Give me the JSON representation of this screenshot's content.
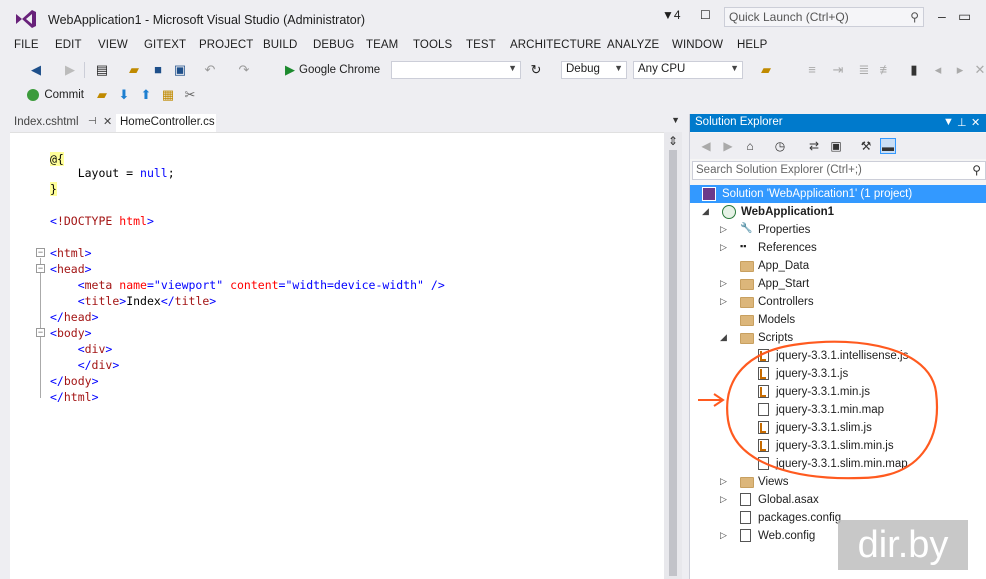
{
  "window": {
    "title": "WebApplication1 - Microsoft Visual Studio (Administrator)",
    "notification_count": "4",
    "quick_launch_placeholder": "Quick Launch (Ctrl+Q)"
  },
  "menu": [
    "FILE",
    "EDIT",
    "VIEW",
    "GITEXT",
    "PROJECT",
    "BUILD",
    "DEBUG",
    "TEAM",
    "TOOLS",
    "TEST",
    "ARCHITECTURE",
    "ANALYZE",
    "WINDOW",
    "HELP"
  ],
  "toolbar": {
    "run_target": "Google Chrome",
    "configuration": "Debug",
    "platform": "Any CPU",
    "commit_label": "Commit"
  },
  "editor": {
    "tabs": [
      {
        "label": "Index.cshtml",
        "active": false
      },
      {
        "label": "HomeController.cs",
        "active": true
      }
    ]
  },
  "solution_explorer": {
    "title": "Solution Explorer",
    "search_placeholder": "Search Solution Explorer (Ctrl+;)",
    "solution": "Solution 'WebApplication1' (1 project)",
    "project": "WebApplication1",
    "items": [
      {
        "label": "Properties",
        "type": "properties",
        "expandable": true
      },
      {
        "label": "References",
        "type": "references",
        "expandable": true
      },
      {
        "label": "App_Data",
        "type": "folder",
        "expandable": false
      },
      {
        "label": "App_Start",
        "type": "folder",
        "expandable": true
      },
      {
        "label": "Controllers",
        "type": "folder",
        "expandable": true
      },
      {
        "label": "Models",
        "type": "folder",
        "expandable": false
      },
      {
        "label": "Scripts",
        "type": "folder-open",
        "expandable": true
      },
      {
        "label": "jquery-3.3.1.intellisense.js",
        "type": "js",
        "indent": 1
      },
      {
        "label": "jquery-3.3.1.js",
        "type": "js",
        "indent": 1
      },
      {
        "label": "jquery-3.3.1.min.js",
        "type": "js",
        "indent": 1
      },
      {
        "label": "jquery-3.3.1.min.map",
        "type": "map",
        "indent": 1
      },
      {
        "label": "jquery-3.3.1.slim.js",
        "type": "js",
        "indent": 1
      },
      {
        "label": "jquery-3.3.1.slim.min.js",
        "type": "js",
        "indent": 1
      },
      {
        "label": "jquery-3.3.1.slim.min.map",
        "type": "map",
        "indent": 1
      },
      {
        "label": "Views",
        "type": "folder",
        "expandable": true
      },
      {
        "label": "Global.asax",
        "type": "config",
        "expandable": true
      },
      {
        "label": "packages.config",
        "type": "config",
        "expandable": false
      },
      {
        "label": "Web.config",
        "type": "config",
        "expandable": true
      }
    ]
  },
  "watermark": "dir.by",
  "colors": {
    "accent": "#007acc",
    "selection": "#3399ff",
    "annotation": "#ff5a1f"
  }
}
